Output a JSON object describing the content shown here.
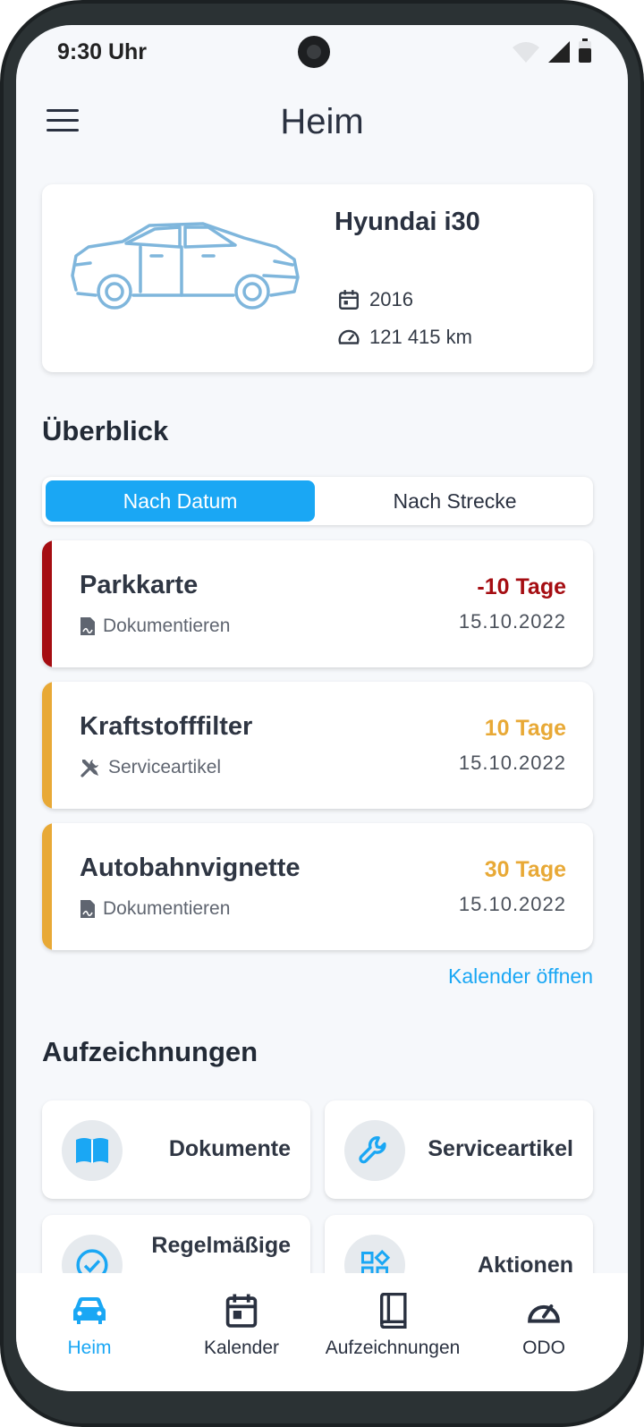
{
  "status_bar": {
    "time": "9:30 Uhr"
  },
  "app_bar": {
    "title": "Heim"
  },
  "vehicle": {
    "name": "Hyundai i30",
    "year": "2016",
    "odometer": "121 415 km"
  },
  "overview": {
    "title": "Überblick",
    "tabs": [
      {
        "label": "Nach Datum",
        "active": true
      },
      {
        "label": "Nach Strecke",
        "active": false
      }
    ],
    "reminders": [
      {
        "title": "Parkkarte",
        "category": "Dokumentieren",
        "category_icon": "document-icon",
        "days": "-10 Tage",
        "date": "15.10.2022",
        "color": "#a50d12"
      },
      {
        "title": "Kraftstofffilter",
        "category": "Serviceartikel",
        "category_icon": "tools-icon",
        "days": "10 Tage",
        "date": "15.10.2022",
        "color": "#e8a936"
      },
      {
        "title": "Autobahnvignette",
        "category": "Dokumentieren",
        "category_icon": "document-icon",
        "days": "30 Tage",
        "date": "15.10.2022",
        "color": "#e8a936"
      }
    ],
    "calendar_link": "Kalender öffnen"
  },
  "records": {
    "title": "Aufzeichnungen",
    "items": [
      {
        "label": "Dokumente",
        "icon": "book-icon"
      },
      {
        "label": "Serviceartikel",
        "icon": "wrench-icon"
      },
      {
        "label": "Regelmäßige",
        "icon": "check-circle-icon"
      },
      {
        "label": "Aktionen",
        "icon": "apps-icon"
      }
    ]
  },
  "bottom_nav": [
    {
      "label": "Heim",
      "icon": "car-icon",
      "active": true
    },
    {
      "label": "Kalender",
      "icon": "calendar-icon",
      "active": false
    },
    {
      "label": "Aufzeichnungen",
      "icon": "book-icon",
      "active": false
    },
    {
      "label": "ODO",
      "icon": "speedometer-icon",
      "active": false
    }
  ],
  "colors": {
    "accent": "#1aa7f4",
    "overdue": "#a50d12",
    "upcoming": "#e8a936",
    "car_outline": "#7fb6dc"
  }
}
